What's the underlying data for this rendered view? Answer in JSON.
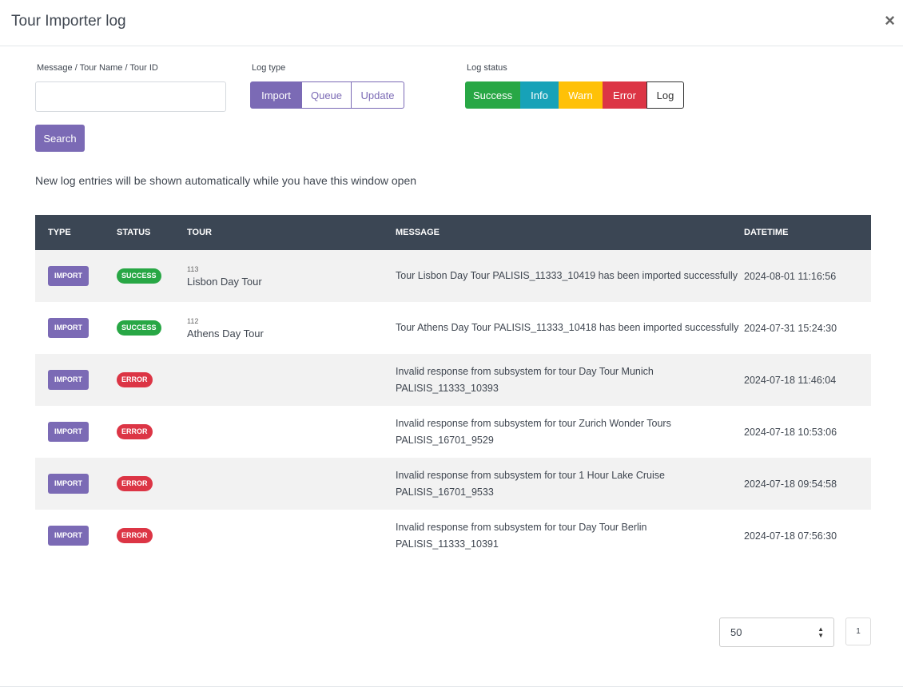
{
  "modal": {
    "title": "Tour Importer log",
    "close_icon": "×"
  },
  "filters": {
    "search_label": "Message / Tour Name / Tour ID",
    "search_value": "",
    "search_placeholder": "",
    "log_type_label": "Log type",
    "log_types": [
      {
        "label": "Import",
        "active": true
      },
      {
        "label": "Queue",
        "active": false
      },
      {
        "label": "Update",
        "active": false
      }
    ],
    "log_status_label": "Log status",
    "log_statuses": [
      {
        "label": "Success",
        "color": "#28a745"
      },
      {
        "label": "Info",
        "color": "#17a2b8"
      },
      {
        "label": "Warn",
        "color": "#ffc107"
      },
      {
        "label": "Error",
        "color": "#dc3545"
      },
      {
        "label": "Log",
        "color": "#ffffff"
      }
    ],
    "search_button": "Search"
  },
  "note": "New log entries will be shown automatically while you have this window open",
  "table": {
    "headers": {
      "type": "TYPE",
      "status": "STATUS",
      "tour": "TOUR",
      "message": "MESSAGE",
      "datetime": "DATETIME"
    },
    "rows": [
      {
        "type": "IMPORT",
        "status": "SUCCESS",
        "tour_id": "113",
        "tour_name": "Lisbon Day Tour",
        "message": "Tour Lisbon Day Tour PALISIS_11333_10419 has been imported successfully",
        "datetime": "2024-08-01 11:16:56"
      },
      {
        "type": "IMPORT",
        "status": "SUCCESS",
        "tour_id": "112",
        "tour_name": "Athens Day Tour",
        "message": "Tour Athens Day Tour PALISIS_11333_10418 has been imported successfully",
        "datetime": "2024-07-31 15:24:30"
      },
      {
        "type": "IMPORT",
        "status": "ERROR",
        "tour_id": "",
        "tour_name": "",
        "message": "Invalid response from subsystem for tour Day Tour Munich PALISIS_11333_10393",
        "datetime": "2024-07-18 11:46:04"
      },
      {
        "type": "IMPORT",
        "status": "ERROR",
        "tour_id": "",
        "tour_name": "",
        "message": "Invalid response from subsystem for tour Zurich Wonder Tours PALISIS_16701_9529",
        "datetime": "2024-07-18 10:53:06"
      },
      {
        "type": "IMPORT",
        "status": "ERROR",
        "tour_id": "",
        "tour_name": "",
        "message": "Invalid response from subsystem for tour 1 Hour Lake Cruise PALISIS_16701_9533",
        "datetime": "2024-07-18 09:54:58"
      },
      {
        "type": "IMPORT",
        "status": "ERROR",
        "tour_id": "",
        "tour_name": "",
        "message": "Invalid response from subsystem for tour Day Tour Berlin PALISIS_11333_10391",
        "datetime": "2024-07-18 07:56:30"
      }
    ]
  },
  "pagination": {
    "per_page": "50",
    "current_page": "1"
  },
  "colors": {
    "accent": "#7b6ab5",
    "header_bg": "#3b4654",
    "success": "#28a745",
    "error": "#dc3545"
  }
}
